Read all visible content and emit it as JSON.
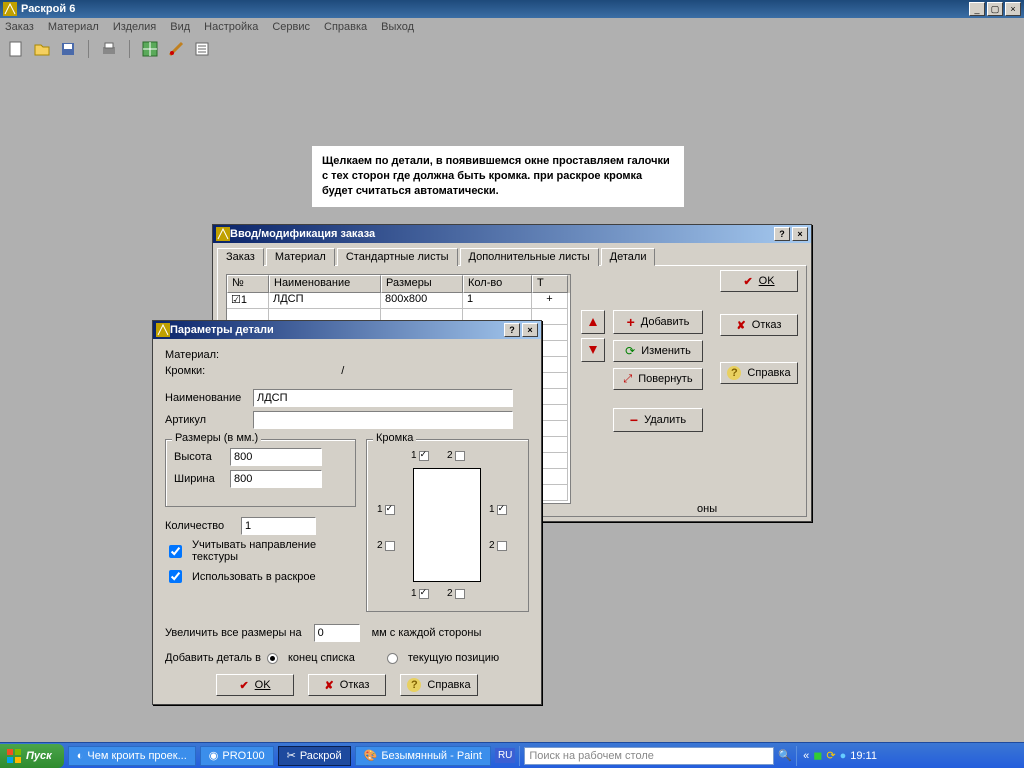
{
  "app": {
    "title": "Раскрой 6"
  },
  "menu": [
    "Заказ",
    "Материал",
    "Изделия",
    "Вид",
    "Настройка",
    "Сервис",
    "Справка",
    "Выход"
  ],
  "note": "Щелкаем по детали, в появившемся окне проставляем галочки с тех сторон где должна быть кромка. при раскрое кромка будет считаться автоматически.",
  "order_window": {
    "title": "Ввод/модификация заказа",
    "tabs": [
      "Заказ",
      "Материал",
      "Стандартные листы",
      "Дополнительные листы",
      "Детали"
    ],
    "grid": {
      "headers": {
        "n": "№",
        "name": "Наименование",
        "size": "Размеры",
        "qty": "Кол-во",
        "t": "Т"
      },
      "rows": [
        {
          "check": true,
          "n": "1",
          "name": "ЛДСП",
          "size": "800x800",
          "qty": "1",
          "t": "+"
        }
      ]
    },
    "buttons": {
      "add": "Добавить",
      "edit": "Изменить",
      "rotate": "Повернуть",
      "delete": "Удалить",
      "ok": "OK",
      "cancel": "Отказ",
      "help": "Справка"
    },
    "sides_hint": "оны"
  },
  "details_dialog": {
    "title": "Параметры детали",
    "material_lbl": "Материал:",
    "edges_lbl": "Кромки:",
    "edges_val": "/",
    "name_lbl": "Наименование",
    "name_val": "ЛДСП",
    "sku_lbl": "Артикул",
    "sku_val": "",
    "size_legend": "Размеры (в мм.)",
    "height_lbl": "Высота",
    "height_val": "800",
    "width_lbl": "Ширина",
    "width_val": "800",
    "qty_lbl": "Количество",
    "qty_val": "1",
    "texture_chk": "Учитывать направление текстуры",
    "use_chk": "Использовать в раскрое",
    "kromka_legend": "Кромка",
    "grow_lbl": "Увеличить все размеры на",
    "grow_val": "0",
    "grow_suffix": "мм с каждой стороны",
    "addto_lbl": "Добавить деталь в",
    "addto_end": "конец списка",
    "addto_cur": "текущую позицию",
    "ok": "OK",
    "cancel": "Отказ",
    "help": "Справка"
  },
  "taskbar": {
    "start": "Пуск",
    "tasks": [
      "Чем кроить проек...",
      "PRO100",
      "Раскрой",
      "Безымянный - Paint"
    ],
    "lang": "RU",
    "search_placeholder": "Поиск на рабочем столе",
    "time": "19:11"
  }
}
